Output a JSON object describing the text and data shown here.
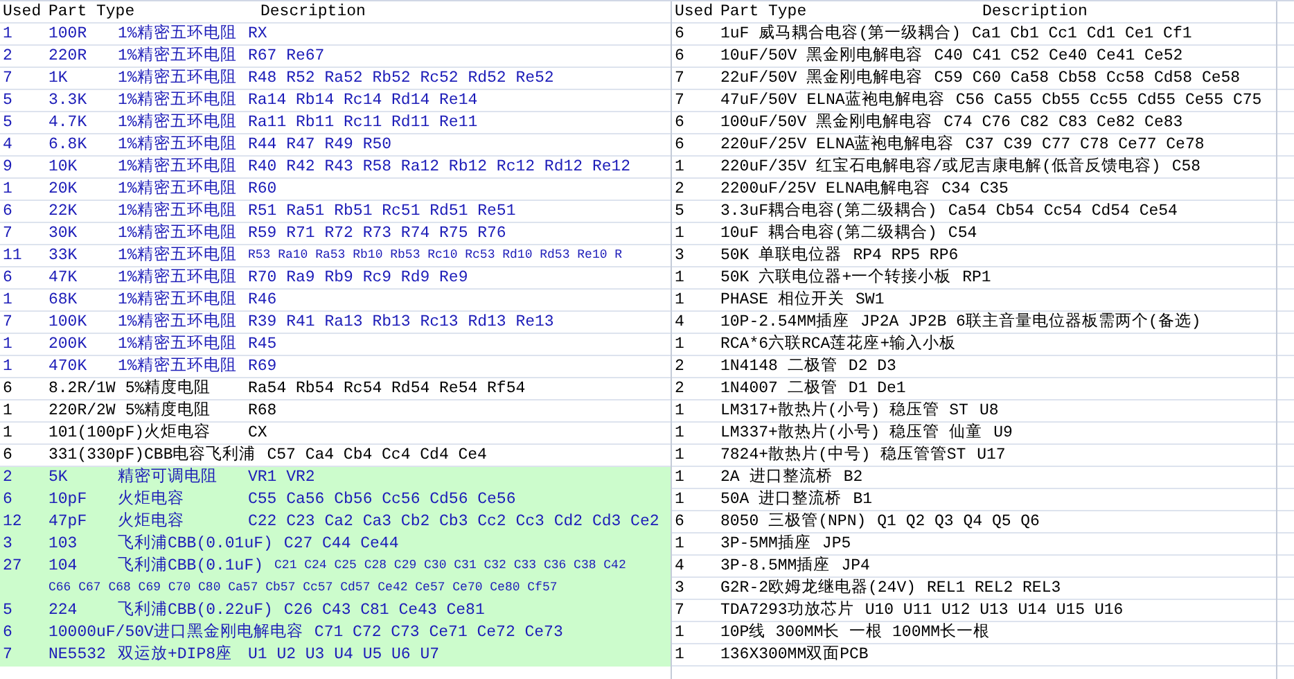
{
  "sheets": [
    {
      "header": {
        "used": "Used",
        "part_type": "Part Type",
        "description": "Description"
      },
      "rows": [
        {
          "used": "1",
          "part": "100R",
          "type": "1%精密五环电阻",
          "description": "RX",
          "color": "#1c1cb8",
          "highlighted": false
        },
        {
          "used": "2",
          "part": "220R",
          "type": "1%精密五环电阻",
          "description": "R67 Re67",
          "color": "#1c1cb8",
          "highlighted": false
        },
        {
          "used": "7",
          "part": "1K",
          "type": "1%精密五环电阻",
          "description": "R48 R52 Ra52 Rb52 Rc52 Rd52 Re52",
          "color": "#1c1cb8",
          "highlighted": false
        },
        {
          "used": "5",
          "part": "3.3K",
          "type": "1%精密五环电阻",
          "description": "Ra14 Rb14 Rc14 Rd14 Re14",
          "color": "#1c1cb8",
          "highlighted": false
        },
        {
          "used": "5",
          "part": "4.7K",
          "type": "1%精密五环电阻",
          "description": "Ra11 Rb11 Rc11 Rd11 Re11",
          "color": "#1c1cb8",
          "highlighted": false
        },
        {
          "used": "4",
          "part": "6.8K",
          "type": "1%精密五环电阻",
          "description": "R44 R47 R49 R50",
          "color": "#1c1cb8",
          "highlighted": false
        },
        {
          "used": "9",
          "part": "10K",
          "type": "1%精密五环电阻",
          "description": "R40 R42 R43 R58 Ra12 Rb12 Rc12 Rd12 Re12",
          "color": "#1c1cb8",
          "highlighted": false
        },
        {
          "used": "1",
          "part": "20K",
          "type": "1%精密五环电阻",
          "description": "R60",
          "color": "#1c1cb8",
          "highlighted": false
        },
        {
          "used": "6",
          "part": "22K",
          "type": "1%精密五环电阻",
          "description": "R51 Ra51 Rb51 Rc51 Rd51 Re51",
          "color": "#1c1cb8",
          "highlighted": false
        },
        {
          "used": "7",
          "part": "30K",
          "type": "1%精密五环电阻",
          "description": "R59 R71 R72 R73 R74 R75 R76",
          "color": "#1c1cb8",
          "highlighted": false
        },
        {
          "used": "11",
          "part": "33K",
          "type": "1%精密五环电阻",
          "description": "R53 Ra10 Ra53 Rb10 Rb53 Rc10 Rc53 Rd10 Rd53 Re10 R",
          "compact": true,
          "color": "#1c1cb8",
          "highlighted": false
        },
        {
          "used": "6",
          "part": "47K",
          "type": "1%精密五环电阻",
          "description": "R70 Ra9 Rb9 Rc9 Rd9 Re9",
          "color": "#1c1cb8",
          "highlighted": false
        },
        {
          "used": "1",
          "part": "68K",
          "type": "1%精密五环电阻",
          "description": "R46",
          "color": "#1c1cb8",
          "highlighted": false
        },
        {
          "used": "7",
          "part": "100K",
          "type": "1%精密五环电阻",
          "description": "R39 R41 Ra13 Rb13 Rc13 Rd13 Re13",
          "color": "#1c1cb8",
          "highlighted": false
        },
        {
          "used": "1",
          "part": "200K",
          "type": "1%精密五环电阻",
          "description": "R45",
          "color": "#1c1cb8",
          "highlighted": false
        },
        {
          "used": "1",
          "part": "470K",
          "type": "1%精密五环电阻",
          "description": "R69",
          "color": "#1c1cb8",
          "highlighted": false
        },
        {
          "used": "6",
          "part": "8.2R/1W",
          "type": "5%精度电阻",
          "description": "Ra54 Rb54 Rc54 Rd54 Re54 Rf54",
          "color": "#000000",
          "highlighted": false
        },
        {
          "used": "1",
          "part": "220R/2W",
          "type": "5%精度电阻",
          "description": "R68",
          "color": "#000000",
          "highlighted": false
        },
        {
          "used": "1",
          "part": "101(100pF)火炬电容",
          "description": "CX",
          "color": "#000000",
          "highlighted": false
        },
        {
          "used": "6",
          "part": "331(330pF)CBB电容飞利浦",
          "description": "C57 Ca4 Cb4 Cc4 Cd4 Ce4",
          "color": "#000000",
          "highlighted": false
        },
        {
          "used": "2",
          "part": "5K",
          "type": "精密可调电阻",
          "description": "VR1 VR2",
          "color": "#1c1cb8",
          "highlighted": true
        },
        {
          "used": "6",
          "part": "10pF",
          "type": "火炬电容",
          "description": "C55 Ca56 Cb56 Cc56 Cd56 Ce56",
          "color": "#1c1cb8",
          "highlighted": true
        },
        {
          "used": "12",
          "part": "47pF",
          "type": "火炬电容",
          "description": "C22 C23 Ca2 Ca3 Cb2 Cb3 Cc2 Cc3 Cd2 Cd3 Ce2",
          "color": "#1c1cb8",
          "highlighted": true
        },
        {
          "used": "3",
          "part": "103",
          "type": "飞利浦CBB(0.01uF)",
          "description": "C27 C44 Ce44",
          "color": "#1c1cb8",
          "highlighted": true
        },
        {
          "used": "27",
          "part": "104",
          "type": "飞利浦CBB(0.1uF)",
          "description": "C21 C24 C25 C28 C29 C30  C31 C32 C33 C36 C38 C42",
          "compact": true,
          "color": "#1c1cb8",
          "highlighted": true
        },
        {
          "description": "C66 C67 C68 C69 C70 C80 Ca57 Cb57 Cc57 Cd57 Ce42 Ce57 Ce70 Ce80 Cf57",
          "compact": true,
          "color": "#1c1cb8",
          "highlighted": true
        },
        {
          "used": "5",
          "part": "224",
          "type": "飞利浦CBB(0.22uF)",
          "description": "C26 C43 C81 Ce43 Ce81",
          "color": "#1c1cb8",
          "highlighted": true
        },
        {
          "used": "6",
          "part": "10000uF/50V进口黑金刚电解电容",
          "description": "C71 C72 C73 Ce71 Ce72 Ce73",
          "color": "#1c1cb8",
          "highlighted": true
        },
        {
          "used": "7",
          "part": "NE5532",
          "type": "双运放+DIP8座",
          "description": "U1 U2 U3 U4 U5 U6 U7",
          "color": "#1c1cb8",
          "highlighted": true
        }
      ]
    },
    {
      "header": {
        "used": "Used",
        "part_type": "Part Type",
        "description": "Description"
      },
      "rows": [
        {
          "used": "6",
          "part": "1uF",
          "type": "威马耦合电容(第一级耦合)",
          "description": "Ca1 Cb1 Cc1 Cd1 Ce1 Cf1"
        },
        {
          "used": "6",
          "part": "10uF/50V",
          "type": "黑金刚电解电容",
          "description": "C40 C41 C52 Ce40 Ce41 Ce52"
        },
        {
          "used": "7",
          "part": "22uF/50V",
          "type": "黑金刚电解电容",
          "description": "C59 C60 Ca58 Cb58 Cc58 Cd58 Ce58"
        },
        {
          "used": "7",
          "part": "47uF/50V",
          "type": "ELNA蓝袍电解电容",
          "description": "C56 Ca55 Cb55 Cc55 Cd55 Ce55 C75"
        },
        {
          "used": "6",
          "part": "100uF/50V",
          "type": "黑金刚电解电容",
          "description": "C74 C76 C82 C83 Ce82 Ce83"
        },
        {
          "used": "6",
          "part": "220uF/25V",
          "type": "ELNA蓝袍电解电容",
          "description": "C37 C39 C77 C78 Ce77 Ce78"
        },
        {
          "used": "1",
          "part": "220uF/35V",
          "type": "红宝石电解电容/或尼吉康电解(低音反馈电容)",
          "description": "C58"
        },
        {
          "used": "2",
          "part": "2200uF/25V",
          "type": "ELNA电解电容",
          "description": "C34 C35"
        },
        {
          "used": "5",
          "part": "3.3uF耦合电容(第二级耦合)",
          "description": "Ca54 Cb54 Cc54 Cd54 Ce54"
        },
        {
          "used": "1",
          "part": "10uF",
          "type": "耦合电容(第二级耦合)",
          "description": "C54"
        },
        {
          "used": "3",
          "part": "50K",
          "type": "单联电位器",
          "description": "RP4 RP5 RP6"
        },
        {
          "used": "1",
          "part": "50K",
          "type": "六联电位器+一个转接小板",
          "description": "RP1"
        },
        {
          "used": "1",
          "part": "PHASE",
          "type": "相位开关",
          "description": "SW1"
        },
        {
          "used": "4",
          "part": "10P-2.54MM插座",
          "description": "JP2A JP2B 6联主音量电位器板需两个(备选)"
        },
        {
          "used": "1",
          "part": "RCA*6六联RCA莲花座+输入小板"
        },
        {
          "used": "2",
          "part": "1N4148",
          "type": "二极管",
          "description": "D2 D3"
        },
        {
          "used": "2",
          "part": "1N4007",
          "type": "二极管",
          "description": "D1 De1"
        },
        {
          "used": "1",
          "part": "LM317+散热片(小号)",
          "type": "稳压管 ST",
          "description": "U8"
        },
        {
          "used": "1",
          "part": "LM337+散热片(小号)",
          "type": "稳压管 仙童",
          "description": "U9"
        },
        {
          "used": "1",
          "part": "7824+散热片(中号)",
          "type": "稳压管管ST",
          "description": "U17"
        },
        {
          "used": "1",
          "part": "2A",
          "type": "进口整流桥",
          "description": "B2"
        },
        {
          "used": "1",
          "part": "50A",
          "type": "进口整流桥",
          "description": "B1"
        },
        {
          "used": "6",
          "part": "8050",
          "type": "三极管(NPN)",
          "description": "Q1 Q2 Q3 Q4 Q5 Q6"
        },
        {
          "used": "1",
          "part": "3P-5MM插座",
          "description": "JP5"
        },
        {
          "used": "4",
          "part": "3P-8.5MM插座",
          "description": "JP4"
        },
        {
          "used": "3",
          "part": "G2R-2欧姆龙继电器(24V)",
          "description": "REL1 REL2 REL3"
        },
        {
          "used": "7",
          "part": "TDA7293功放芯片",
          "description": "U10 U11 U12 U13 U14 U15 U16"
        },
        {
          "used": "1",
          "part": "10P线",
          "type": "300MM长 一根 100MM长一根"
        },
        {
          "used": "1",
          "part": "136X300MM双面PCB"
        }
      ]
    }
  ]
}
